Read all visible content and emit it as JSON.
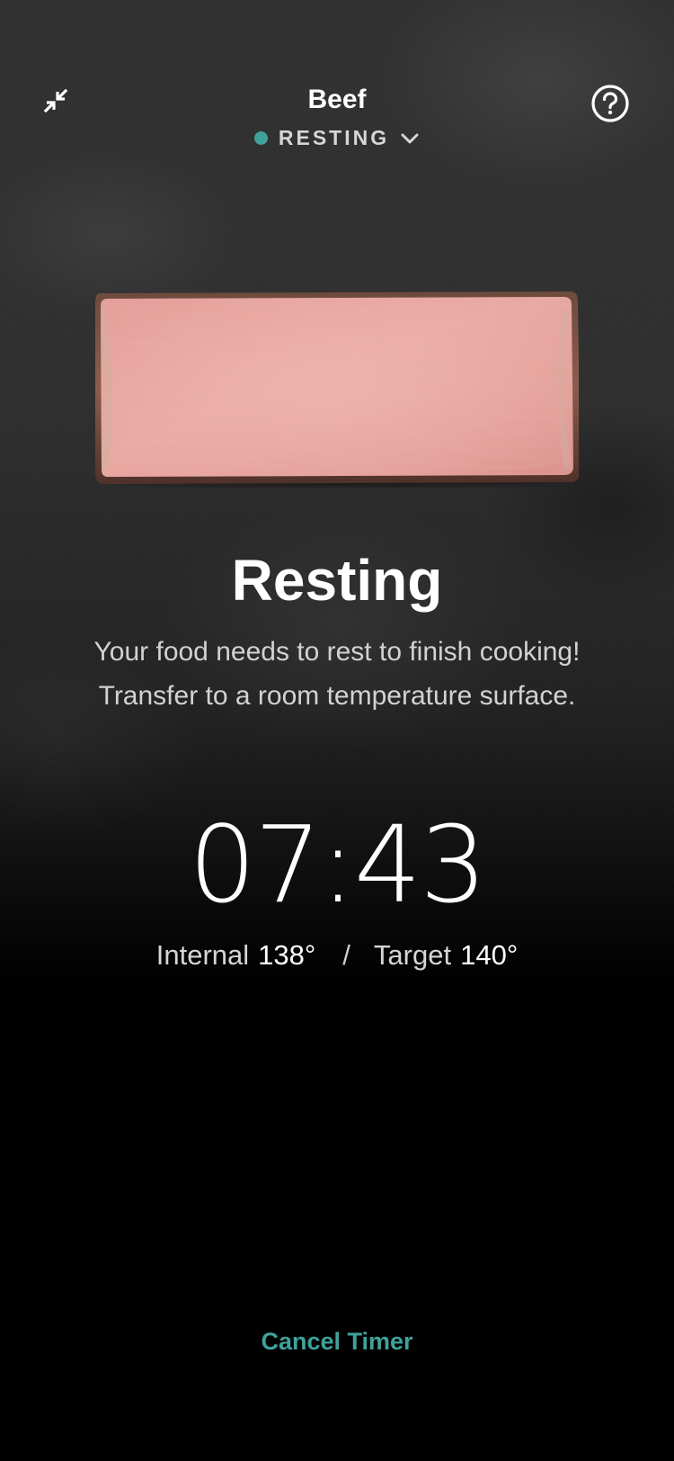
{
  "header": {
    "title": "Beef",
    "status": "RESTING",
    "collapse_icon": "collapse-arrows-icon",
    "help_icon": "help-circle-icon",
    "dropdown_icon": "chevron-down-icon"
  },
  "main": {
    "image": "steak-cross-section",
    "title": "Resting",
    "description_line1": "Your food needs to rest to finish cooking!",
    "description_line2": "Transfer to a room temperature surface.",
    "timer": "07:43",
    "internal_label": "Internal",
    "internal_value": "138°",
    "separator": "/",
    "target_label": "Target",
    "target_value": "140°"
  },
  "footer": {
    "cancel_label": "Cancel Timer"
  },
  "colors": {
    "accent": "#3fa29a",
    "background": "#000000"
  }
}
